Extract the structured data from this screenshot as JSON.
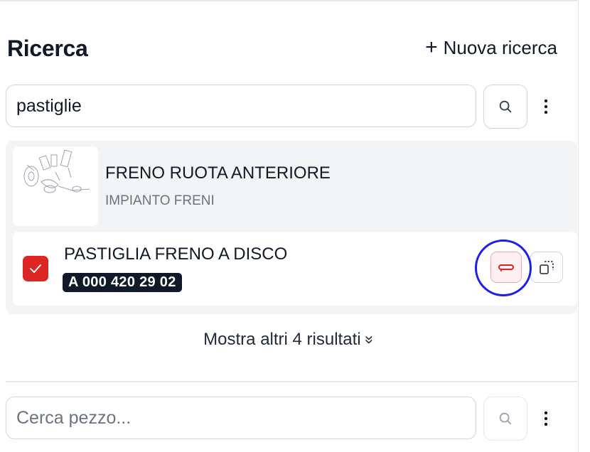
{
  "header": {
    "title": "Ricerca",
    "new_search_label": "Nuova ricerca"
  },
  "search": {
    "value": "pastiglie"
  },
  "result_group": {
    "title": "FRENO RUOTA ANTERIORE",
    "subtitle": "IMPIANTO FRENI",
    "items": [
      {
        "title": "PASTIGLIA FRENO A DISCO",
        "code": "A 000 420 29 02",
        "checked": true
      }
    ]
  },
  "show_more_label": "Mostra altri 4 risultati",
  "part_search": {
    "placeholder": "Cerca pezzo..."
  },
  "colors": {
    "accent_red": "#dc2626",
    "code_badge_bg": "#111827",
    "highlight_ring": "#1d1df0"
  }
}
